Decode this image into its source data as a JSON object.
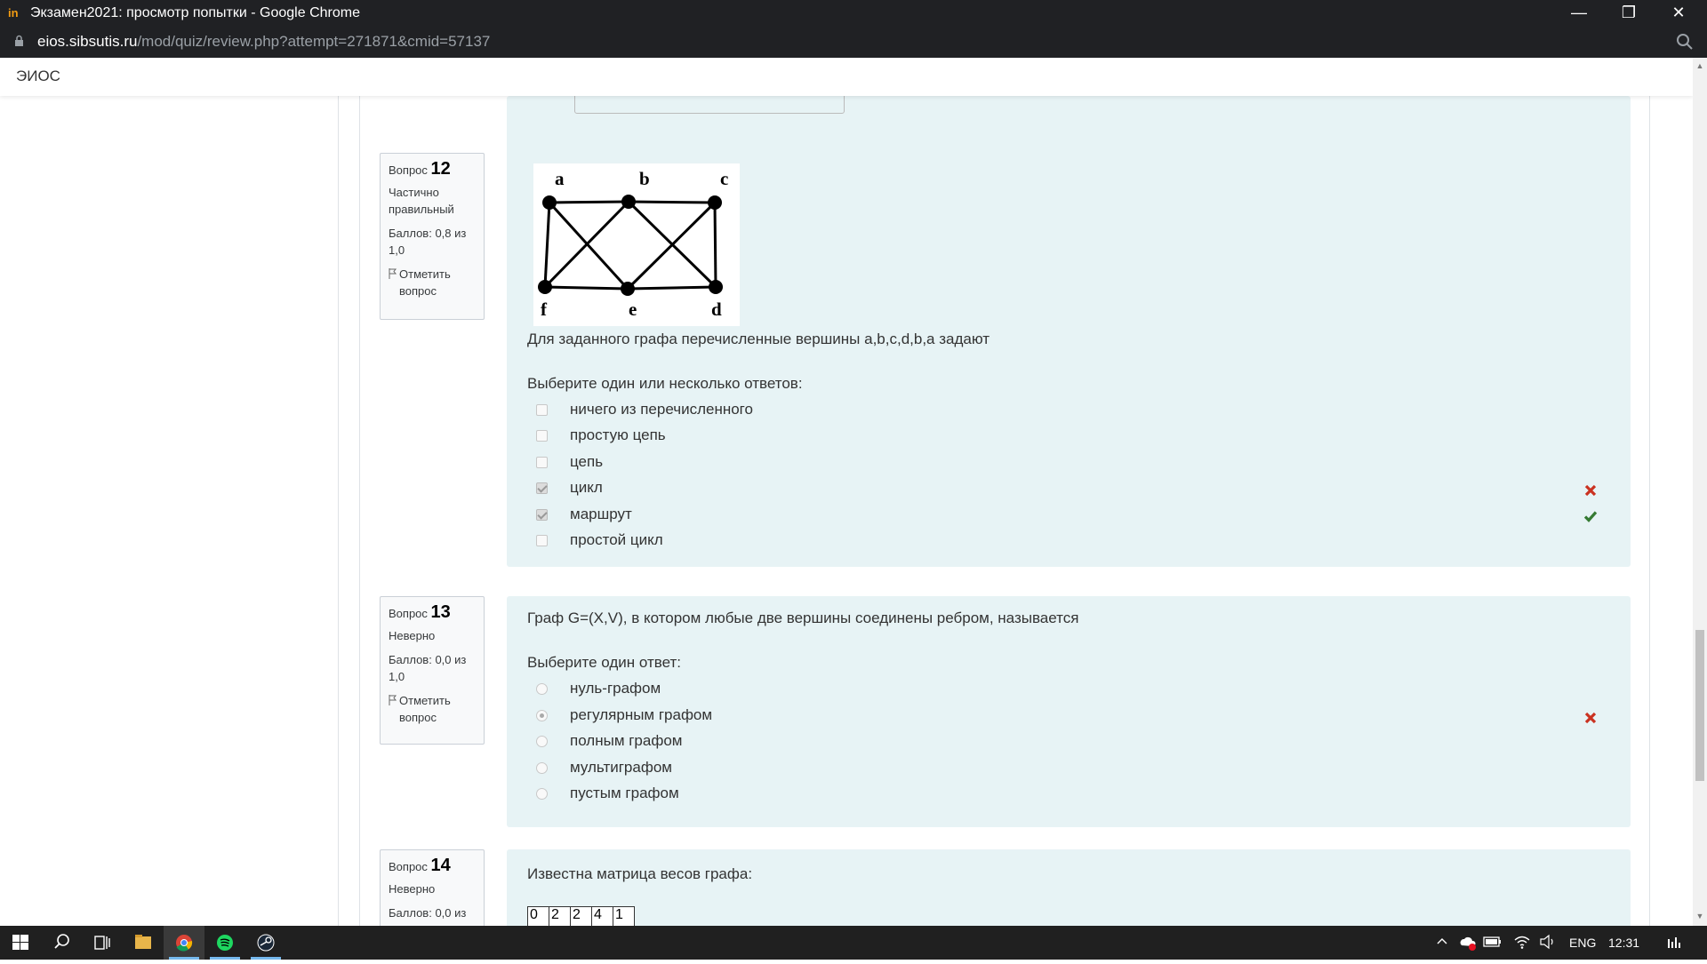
{
  "browser": {
    "window_title": "Экзамен2021: просмотр попытки - Google Chrome",
    "url_domain": "eios.sibsutis.ru",
    "url_path": "/mod/quiz/review.php?attempt=271871&cmid=57137"
  },
  "navbar": {
    "brand": "ЭИОС"
  },
  "questions": [
    {
      "label": "Вопрос",
      "number": "12",
      "state": "Частично правильный",
      "grade": "Баллов: 0,8 из 1,0",
      "flag": "Отметить вопрос",
      "graph_vertices": [
        "a",
        "b",
        "c",
        "d",
        "e",
        "f"
      ],
      "text": "Для заданного графа перечисленные вершины a,b,c,d,b,a задают",
      "prompt": "Выберите один или несколько ответов:",
      "options": [
        {
          "label": "ничего из перечисленного",
          "checked": false,
          "mark": ""
        },
        {
          "label": "простую цепь",
          "checked": false,
          "mark": ""
        },
        {
          "label": "цепь",
          "checked": false,
          "mark": ""
        },
        {
          "label": "цикл",
          "checked": true,
          "mark": "incorrect"
        },
        {
          "label": "маршрут",
          "checked": true,
          "mark": "correct"
        },
        {
          "label": "простой цикл",
          "checked": false,
          "mark": ""
        }
      ]
    },
    {
      "label": "Вопрос",
      "number": "13",
      "state": "Неверно",
      "grade": "Баллов: 0,0 из 1,0",
      "flag": "Отметить вопрос",
      "text": "Граф G=(X,V), в котором любые две вершины соединены ребром, называется",
      "prompt": "Выберите один ответ:",
      "options": [
        {
          "label": "нуль-графом",
          "checked": false,
          "mark": ""
        },
        {
          "label": "регулярным графом",
          "checked": true,
          "mark": "incorrect"
        },
        {
          "label": "полным графом",
          "checked": false,
          "mark": ""
        },
        {
          "label": "мультиграфом",
          "checked": false,
          "mark": ""
        },
        {
          "label": "пустым графом",
          "checked": false,
          "mark": ""
        }
      ]
    },
    {
      "label": "Вопрос",
      "number": "14",
      "state": "Неверно",
      "grade": "Баллов: 0,0 из",
      "text": "Известна матрица весов графа:",
      "matrix_row": [
        "0",
        "2",
        "2",
        "4",
        "1"
      ]
    }
  ],
  "colors": {
    "incorrect": "#ca3120",
    "correct": "#357a32",
    "content_bg": "#e7f3f5"
  },
  "taskbar": {
    "icons": [
      "windows-start-icon",
      "search-icon",
      "task-view-icon",
      "file-explorer-icon",
      "chrome-icon",
      "spotify-icon",
      "steam-icon"
    ],
    "lang": "ENG",
    "time": "12:31"
  }
}
